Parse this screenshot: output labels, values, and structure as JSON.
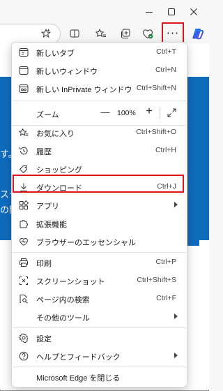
{
  "window_controls": {
    "minimize": "minimize-icon",
    "maximize": "maximize-icon",
    "close": "close-icon"
  },
  "toolbar": {
    "more_label": "···",
    "icons": [
      "favorite-star-icon",
      "split-screen-icon",
      "favorites-icon",
      "collections-icon",
      "browser-essentials-icon",
      "settings-and-more-icon",
      "copilot-icon"
    ]
  },
  "page": {
    "fragments": [
      "す。",
      "ステ",
      "の問"
    ]
  },
  "menu": {
    "new_tab": {
      "label": "新しいタブ",
      "shortcut": "Ctrl+T"
    },
    "new_window": {
      "label": "新しいウィンドウ",
      "shortcut": "Ctrl+N"
    },
    "new_inprivate": {
      "label": "新しい InPrivate ウィンドウ",
      "shortcut": "Ctrl+Shift+N"
    },
    "zoom": {
      "label": "ズーム",
      "minus": "—",
      "value": "100%",
      "plus": "+"
    },
    "favorites": {
      "label": "お気に入り",
      "shortcut": "Ctrl+Shift+O"
    },
    "history": {
      "label": "履歴",
      "shortcut": "Ctrl+H"
    },
    "shopping": {
      "label": "ショッピング"
    },
    "downloads": {
      "label": "ダウンロード",
      "shortcut": "Ctrl+J"
    },
    "apps": {
      "label": "アプリ"
    },
    "extensions": {
      "label": "拡張機能"
    },
    "essentials": {
      "label": "ブラウザーのエッセンシャル"
    },
    "print": {
      "label": "印刷",
      "shortcut": "Ctrl+P"
    },
    "screenshot": {
      "label": "スクリーンショット",
      "shortcut": "Ctrl+Shift+S"
    },
    "find": {
      "label": "ページ内の検索",
      "shortcut": "Ctrl+F"
    },
    "more_tools": {
      "label": "その他のツール"
    },
    "settings": {
      "label": "設定"
    },
    "help": {
      "label": "ヘルプとフィードバック"
    },
    "close_edge": {
      "label": "Microsoft Edge を閉じる"
    }
  },
  "colors": {
    "highlight": "#e0141e",
    "page_blue": "#0f6cbd"
  }
}
